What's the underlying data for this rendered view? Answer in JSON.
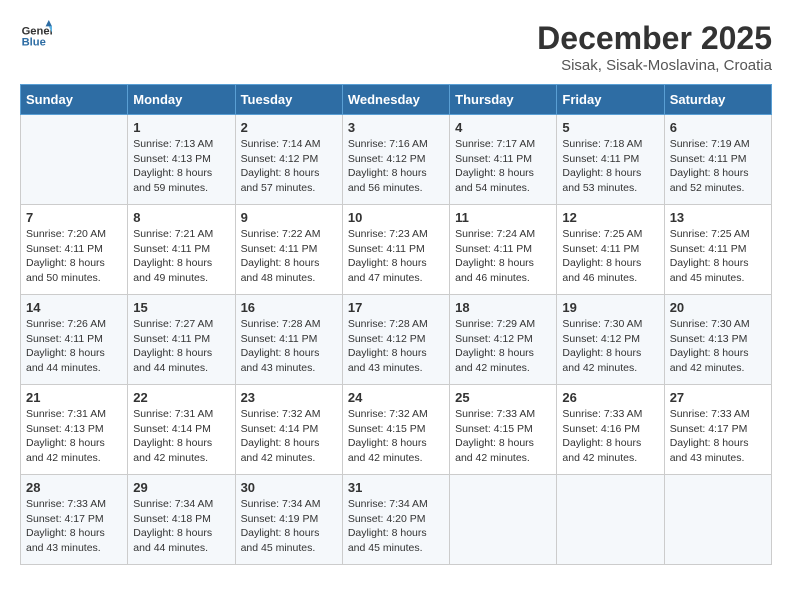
{
  "logo": {
    "line1": "General",
    "line2": "Blue"
  },
  "title": "December 2025",
  "subtitle": "Sisak, Sisak-Moslavina, Croatia",
  "days_of_week": [
    "Sunday",
    "Monday",
    "Tuesday",
    "Wednesday",
    "Thursday",
    "Friday",
    "Saturday"
  ],
  "weeks": [
    [
      {
        "day": "",
        "sunrise": "",
        "sunset": "",
        "daylight": ""
      },
      {
        "day": "1",
        "sunrise": "Sunrise: 7:13 AM",
        "sunset": "Sunset: 4:13 PM",
        "daylight": "Daylight: 8 hours and 59 minutes."
      },
      {
        "day": "2",
        "sunrise": "Sunrise: 7:14 AM",
        "sunset": "Sunset: 4:12 PM",
        "daylight": "Daylight: 8 hours and 57 minutes."
      },
      {
        "day": "3",
        "sunrise": "Sunrise: 7:16 AM",
        "sunset": "Sunset: 4:12 PM",
        "daylight": "Daylight: 8 hours and 56 minutes."
      },
      {
        "day": "4",
        "sunrise": "Sunrise: 7:17 AM",
        "sunset": "Sunset: 4:11 PM",
        "daylight": "Daylight: 8 hours and 54 minutes."
      },
      {
        "day": "5",
        "sunrise": "Sunrise: 7:18 AM",
        "sunset": "Sunset: 4:11 PM",
        "daylight": "Daylight: 8 hours and 53 minutes."
      },
      {
        "day": "6",
        "sunrise": "Sunrise: 7:19 AM",
        "sunset": "Sunset: 4:11 PM",
        "daylight": "Daylight: 8 hours and 52 minutes."
      }
    ],
    [
      {
        "day": "7",
        "sunrise": "Sunrise: 7:20 AM",
        "sunset": "Sunset: 4:11 PM",
        "daylight": "Daylight: 8 hours and 50 minutes."
      },
      {
        "day": "8",
        "sunrise": "Sunrise: 7:21 AM",
        "sunset": "Sunset: 4:11 PM",
        "daylight": "Daylight: 8 hours and 49 minutes."
      },
      {
        "day": "9",
        "sunrise": "Sunrise: 7:22 AM",
        "sunset": "Sunset: 4:11 PM",
        "daylight": "Daylight: 8 hours and 48 minutes."
      },
      {
        "day": "10",
        "sunrise": "Sunrise: 7:23 AM",
        "sunset": "Sunset: 4:11 PM",
        "daylight": "Daylight: 8 hours and 47 minutes."
      },
      {
        "day": "11",
        "sunrise": "Sunrise: 7:24 AM",
        "sunset": "Sunset: 4:11 PM",
        "daylight": "Daylight: 8 hours and 46 minutes."
      },
      {
        "day": "12",
        "sunrise": "Sunrise: 7:25 AM",
        "sunset": "Sunset: 4:11 PM",
        "daylight": "Daylight: 8 hours and 46 minutes."
      },
      {
        "day": "13",
        "sunrise": "Sunrise: 7:25 AM",
        "sunset": "Sunset: 4:11 PM",
        "daylight": "Daylight: 8 hours and 45 minutes."
      }
    ],
    [
      {
        "day": "14",
        "sunrise": "Sunrise: 7:26 AM",
        "sunset": "Sunset: 4:11 PM",
        "daylight": "Daylight: 8 hours and 44 minutes."
      },
      {
        "day": "15",
        "sunrise": "Sunrise: 7:27 AM",
        "sunset": "Sunset: 4:11 PM",
        "daylight": "Daylight: 8 hours and 44 minutes."
      },
      {
        "day": "16",
        "sunrise": "Sunrise: 7:28 AM",
        "sunset": "Sunset: 4:11 PM",
        "daylight": "Daylight: 8 hours and 43 minutes."
      },
      {
        "day": "17",
        "sunrise": "Sunrise: 7:28 AM",
        "sunset": "Sunset: 4:12 PM",
        "daylight": "Daylight: 8 hours and 43 minutes."
      },
      {
        "day": "18",
        "sunrise": "Sunrise: 7:29 AM",
        "sunset": "Sunset: 4:12 PM",
        "daylight": "Daylight: 8 hours and 42 minutes."
      },
      {
        "day": "19",
        "sunrise": "Sunrise: 7:30 AM",
        "sunset": "Sunset: 4:12 PM",
        "daylight": "Daylight: 8 hours and 42 minutes."
      },
      {
        "day": "20",
        "sunrise": "Sunrise: 7:30 AM",
        "sunset": "Sunset: 4:13 PM",
        "daylight": "Daylight: 8 hours and 42 minutes."
      }
    ],
    [
      {
        "day": "21",
        "sunrise": "Sunrise: 7:31 AM",
        "sunset": "Sunset: 4:13 PM",
        "daylight": "Daylight: 8 hours and 42 minutes."
      },
      {
        "day": "22",
        "sunrise": "Sunrise: 7:31 AM",
        "sunset": "Sunset: 4:14 PM",
        "daylight": "Daylight: 8 hours and 42 minutes."
      },
      {
        "day": "23",
        "sunrise": "Sunrise: 7:32 AM",
        "sunset": "Sunset: 4:14 PM",
        "daylight": "Daylight: 8 hours and 42 minutes."
      },
      {
        "day": "24",
        "sunrise": "Sunrise: 7:32 AM",
        "sunset": "Sunset: 4:15 PM",
        "daylight": "Daylight: 8 hours and 42 minutes."
      },
      {
        "day": "25",
        "sunrise": "Sunrise: 7:33 AM",
        "sunset": "Sunset: 4:15 PM",
        "daylight": "Daylight: 8 hours and 42 minutes."
      },
      {
        "day": "26",
        "sunrise": "Sunrise: 7:33 AM",
        "sunset": "Sunset: 4:16 PM",
        "daylight": "Daylight: 8 hours and 42 minutes."
      },
      {
        "day": "27",
        "sunrise": "Sunrise: 7:33 AM",
        "sunset": "Sunset: 4:17 PM",
        "daylight": "Daylight: 8 hours and 43 minutes."
      }
    ],
    [
      {
        "day": "28",
        "sunrise": "Sunrise: 7:33 AM",
        "sunset": "Sunset: 4:17 PM",
        "daylight": "Daylight: 8 hours and 43 minutes."
      },
      {
        "day": "29",
        "sunrise": "Sunrise: 7:34 AM",
        "sunset": "Sunset: 4:18 PM",
        "daylight": "Daylight: 8 hours and 44 minutes."
      },
      {
        "day": "30",
        "sunrise": "Sunrise: 7:34 AM",
        "sunset": "Sunset: 4:19 PM",
        "daylight": "Daylight: 8 hours and 45 minutes."
      },
      {
        "day": "31",
        "sunrise": "Sunrise: 7:34 AM",
        "sunset": "Sunset: 4:20 PM",
        "daylight": "Daylight: 8 hours and 45 minutes."
      },
      {
        "day": "",
        "sunrise": "",
        "sunset": "",
        "daylight": ""
      },
      {
        "day": "",
        "sunrise": "",
        "sunset": "",
        "daylight": ""
      },
      {
        "day": "",
        "sunrise": "",
        "sunset": "",
        "daylight": ""
      }
    ]
  ]
}
